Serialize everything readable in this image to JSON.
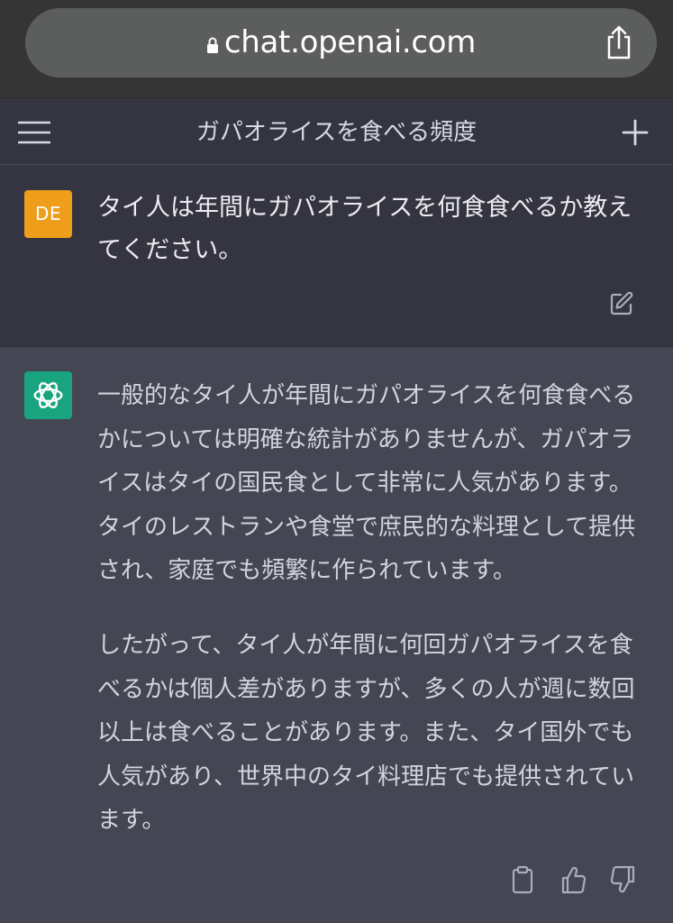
{
  "browser": {
    "url": "chat.openai.com"
  },
  "header": {
    "title": "ガパオライスを食べる頻度"
  },
  "user_message": {
    "avatar_initials": "DE",
    "text": "タイ人は年間にガパオライスを何食食べるか教えてください。"
  },
  "assistant_message": {
    "paragraphs": [
      "一般的なタイ人が年間にガパオライスを何食食べるかについては明確な統計がありませんが、ガパオライスはタイの国民食として非常に人気があります。タイのレストランや食堂で庶民的な料理として提供され、家庭でも頻繁に作られています。",
      "したがって、タイ人が年間に何回ガパオライスを食べるかは個人差がありますが、多くの人が週に数回以上は食べることがあります。また、タイ国外でも人気があり、世界中のタイ料理店でも提供されています。"
    ]
  },
  "colors": {
    "user_avatar": "#ee9e1a",
    "bot_avatar": "#19a37f",
    "user_bg": "#343541",
    "assistant_bg": "#444654"
  }
}
